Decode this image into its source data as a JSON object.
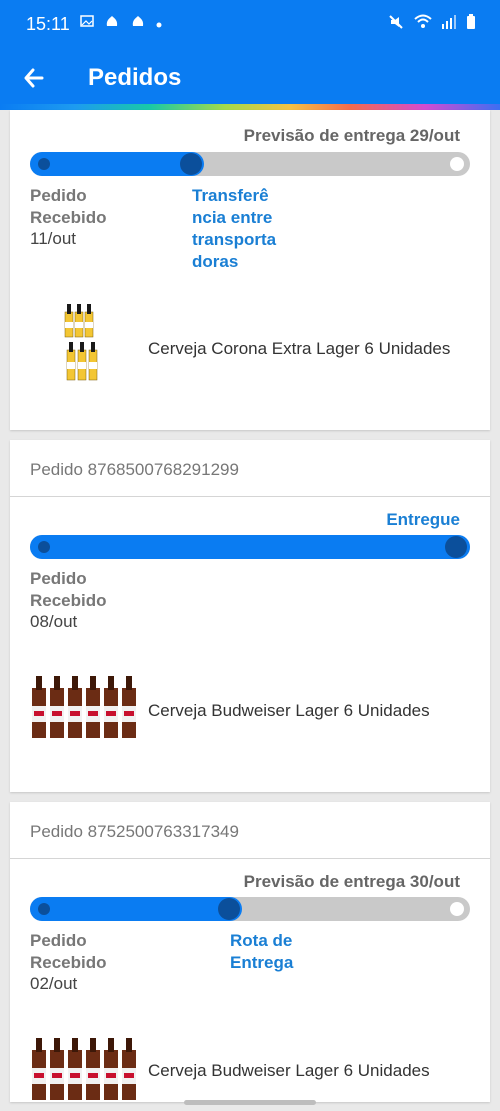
{
  "status": {
    "time": "15:11",
    "left_icons": [
      "image-icon",
      "app-icon",
      "app-icon",
      "dot-icon"
    ],
    "right_icons": [
      "mute-icon",
      "wifi-icon",
      "signal-icon",
      "battery-icon"
    ]
  },
  "appbar": {
    "title": "Pedidos",
    "back_icon": "arrow-left-icon"
  },
  "orders": [
    {
      "order_number": "",
      "forecast": "Previsão de entrega 29/out",
      "step_label": "Pedido\nRecebido",
      "step_date": "11/out",
      "current_status": "Transferê\nncia entre\ntransporta\ndoras",
      "progress_fraction": 0.37,
      "product_name": "Cerveja Corona Extra Lager 6 Unidades"
    },
    {
      "order_number": "Pedido 8768500768291299",
      "delivered": "Entregue",
      "step_label": "Pedido\nRecebido",
      "step_date": "08/out",
      "progress_fraction": 1.0,
      "product_name": "Cerveja Budweiser Lager 6 Unidades"
    },
    {
      "order_number": "Pedido 8752500763317349",
      "forecast": "Previsão de entrega 30/out",
      "step_label": "Pedido\nRecebido",
      "step_date": "02/out",
      "current_status": "Rota de\nEntrega",
      "progress_fraction": 0.46,
      "product_name": "Cerveja Budweiser Lager 6 Unidades"
    }
  ],
  "colors": {
    "primary": "#0a7cf2",
    "status_text": "#1a7fd4",
    "track": "#c9c9c9"
  }
}
